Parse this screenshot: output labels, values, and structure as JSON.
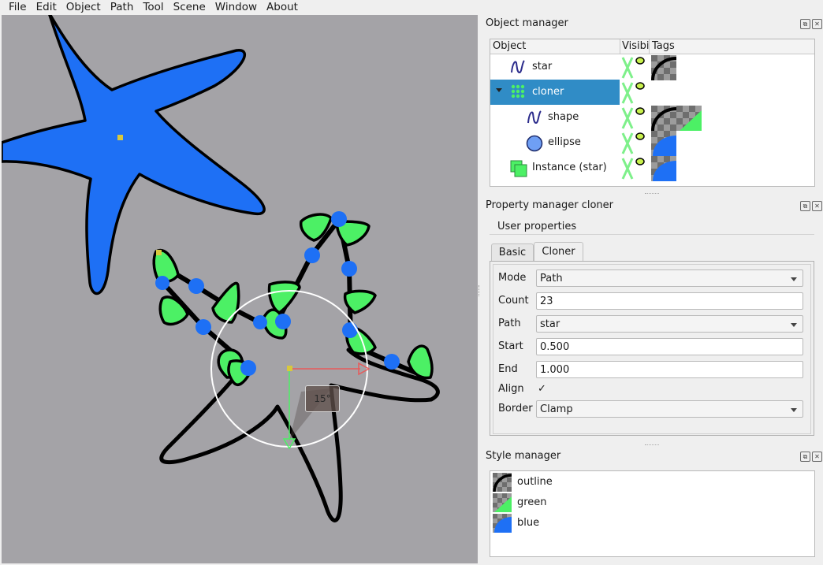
{
  "menu": [
    "File",
    "Edit",
    "Object",
    "Path",
    "Tool",
    "Scene",
    "Window",
    "About"
  ],
  "viewport": {
    "angle_label": "15°",
    "background": "#a4a3a7",
    "star_fill": "#1e70f5",
    "instance_fill": "#4cf065",
    "dot_fill": "#1e70f5"
  },
  "object_manager": {
    "title": "Object manager",
    "columns": [
      "Object",
      "Visibil",
      "Tags"
    ],
    "rows": [
      {
        "name": "star",
        "icon": "path-icon",
        "selected": false
      },
      {
        "name": "cloner",
        "icon": "cloner-icon",
        "selected": true
      },
      {
        "name": "shape",
        "icon": "path-icon",
        "selected": false
      },
      {
        "name": "ellipse",
        "icon": "ellipse-icon",
        "selected": false
      },
      {
        "name": "Instance (star)",
        "icon": "instance-icon",
        "selected": false
      }
    ]
  },
  "property_manager": {
    "title": "Property manager cloner",
    "group": "User properties",
    "tabs": [
      "Basic",
      "Cloner"
    ],
    "active_tab": "Cloner",
    "fields": {
      "mode_label": "Mode",
      "mode_value": "Path",
      "count_label": "Count",
      "count_value": "23",
      "path_label": "Path",
      "path_value": "star",
      "start_label": "Start",
      "start_value": "0.500",
      "end_label": "End",
      "end_value": "1.000",
      "align_label": "Align",
      "align_checked": true,
      "border_label": "Border",
      "border_value": "Clamp"
    }
  },
  "style_manager": {
    "title": "Style manager",
    "styles": [
      {
        "name": "outline",
        "color": "#000000"
      },
      {
        "name": "green",
        "color": "#4cf065"
      },
      {
        "name": "blue",
        "color": "#1e70f5"
      }
    ]
  }
}
